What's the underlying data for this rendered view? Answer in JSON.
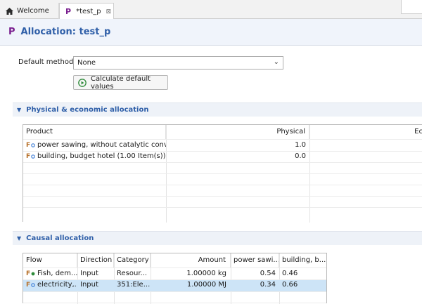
{
  "tabs": {
    "welcome": "Welcome",
    "active": "*test_p"
  },
  "header": {
    "title": "Allocation: test_p"
  },
  "default_method": {
    "label": "Default method",
    "value": "None"
  },
  "calc_button": "Calculate default values",
  "physical_section": {
    "title": "Physical & economic allocation",
    "columns": [
      "Product",
      "Physical",
      "Ec"
    ],
    "rows": [
      {
        "product": "power sawing, without catalytic conver...",
        "physical": "1.0"
      },
      {
        "product": "building, budget hotel (1.00 Item(s))",
        "physical": "0.0"
      }
    ]
  },
  "causal_section": {
    "title": "Causal allocation",
    "columns": [
      "Flow",
      "Direction",
      "Category",
      "Amount",
      "power sawi...",
      "building, b..."
    ],
    "rows": [
      {
        "flow": "Fish, dem...",
        "direction": "Input",
        "category": "Resour...",
        "amount": "1.00000 kg",
        "power": "0.54",
        "building": "0.46"
      },
      {
        "flow": "electricity,...",
        "direction": "Input",
        "category": "351:Ele...",
        "amount": "1.00000 MJ",
        "power": "0.34",
        "building": "0.66"
      }
    ]
  },
  "colors": {
    "accent": "#2f5fa8",
    "process_icon": "#7a1f8f",
    "selected_row": "#cde4f7"
  },
  "icons": [
    "home-icon",
    "process-icon",
    "close-icon",
    "play-icon",
    "product-flow-icon",
    "elementary-flow-icon",
    "chevron-down-icon",
    "collapse-triangle-icon"
  ]
}
